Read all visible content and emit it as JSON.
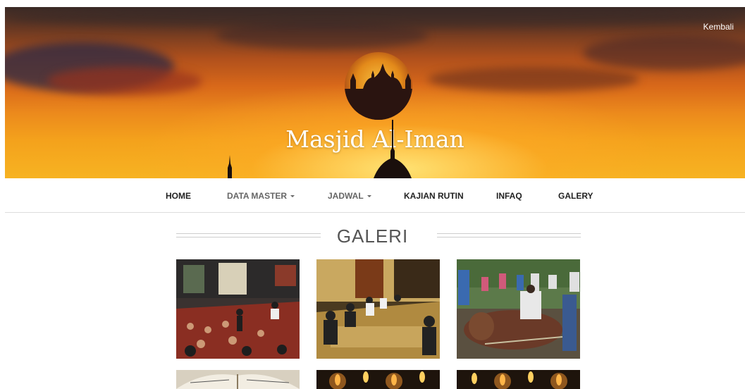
{
  "header": {
    "back_link": "Kembali",
    "site_title": "Masjid Al-Iman"
  },
  "nav": {
    "items": [
      {
        "label": "HOME",
        "dropdown": false
      },
      {
        "label": "DATA MASTER",
        "dropdown": true
      },
      {
        "label": "JADWAL",
        "dropdown": true
      },
      {
        "label": "KAJIAN RUTIN",
        "dropdown": false
      },
      {
        "label": "INFAQ",
        "dropdown": false
      },
      {
        "label": "GALERY",
        "dropdown": false
      }
    ]
  },
  "gallery": {
    "title": "GALERI",
    "photos": [
      {
        "subject": "congregation-hall-gathering"
      },
      {
        "subject": "evening-study-session"
      },
      {
        "subject": "qurban-cattle-slaughter"
      },
      {
        "subject": "quran-book"
      },
      {
        "subject": "candles-night"
      },
      {
        "subject": "candles-night"
      }
    ]
  },
  "colors": {
    "sky_top": "#3a2a26",
    "sky_mid": "#d8681a",
    "sky_bottom": "#f7b322",
    "nav_text": "#222222",
    "divider": "#dddddd"
  }
}
